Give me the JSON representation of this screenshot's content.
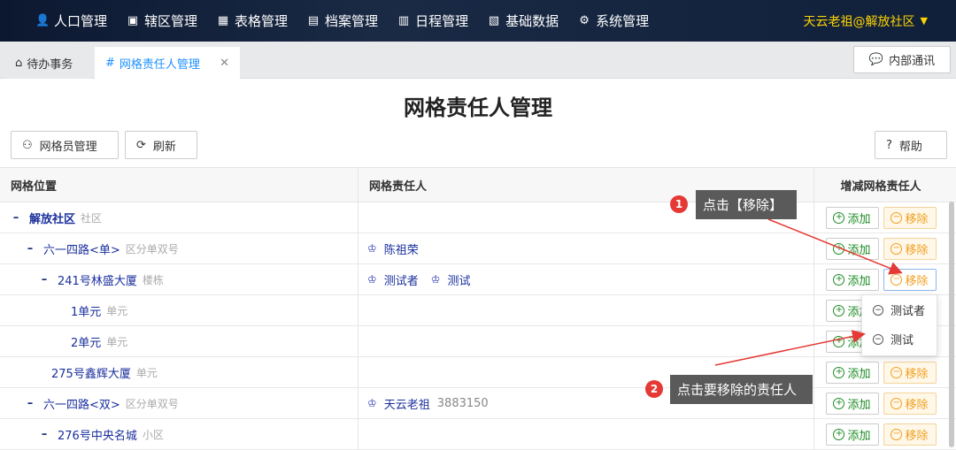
{
  "nav": {
    "items": [
      {
        "label": "人口管理",
        "icon": "person-icon"
      },
      {
        "label": "辖区管理",
        "icon": "district-icon"
      },
      {
        "label": "表格管理",
        "icon": "table-icon"
      },
      {
        "label": "档案管理",
        "icon": "archive-icon"
      },
      {
        "label": "日程管理",
        "icon": "calendar-icon"
      },
      {
        "label": "基础数据",
        "icon": "database-icon"
      },
      {
        "label": "系统管理",
        "icon": "gear-icon"
      }
    ],
    "user": "天云老祖@解放社区"
  },
  "tabs": [
    {
      "label": "待办事务",
      "icon": "home-icon"
    },
    {
      "label": "网格责任人管理",
      "icon": "hash-icon",
      "active": true
    }
  ],
  "intercom_label": "内部通讯",
  "page_title": "网格责任人管理",
  "toolbar": {
    "grid_staff_label": "网格员管理",
    "refresh_label": "刷新",
    "help_label": "帮助"
  },
  "table": {
    "headers": {
      "location": "网格位置",
      "person": "网格责任人",
      "actions": "增减网格责任人"
    },
    "add_label": "添加",
    "remove_label": "移除",
    "rows": [
      {
        "name": "解放社区",
        "type": "社区",
        "level": 0,
        "expand": true,
        "bold": true,
        "persons": []
      },
      {
        "name": "六一四路<单>",
        "type": "区分单双号",
        "level": 1,
        "expand": true,
        "persons": [
          {
            "name": "陈祖荣",
            "phone": ""
          }
        ]
      },
      {
        "name": "241号林盛大厦",
        "type": "楼栋",
        "level": 2,
        "expand": true,
        "persons": [
          {
            "name": "测试者",
            "phone": ""
          },
          {
            "name": "测试",
            "phone": ""
          }
        ]
      },
      {
        "name": "1单元",
        "type": "单元",
        "level": 3,
        "expand": false,
        "persons": []
      },
      {
        "name": "2单元",
        "type": "单元",
        "level": 3,
        "expand": false,
        "persons": []
      },
      {
        "name": "275号鑫辉大厦",
        "type": "单元",
        "level": 2,
        "expand": false,
        "persons": []
      },
      {
        "name": "六一四路<双>",
        "type": "区分单双号",
        "level": 1,
        "expand": true,
        "persons": [
          {
            "name": "天云老祖",
            "phone": "3883150"
          }
        ]
      },
      {
        "name": "276号中央名城",
        "type": "小区",
        "level": 2,
        "expand": true,
        "persons": []
      }
    ]
  },
  "dropdown": {
    "items": [
      "测试者",
      "测试"
    ]
  },
  "annotations": [
    {
      "num": "1",
      "text": "点击【移除】"
    },
    {
      "num": "2",
      "text": "点击要移除的责任人"
    }
  ]
}
